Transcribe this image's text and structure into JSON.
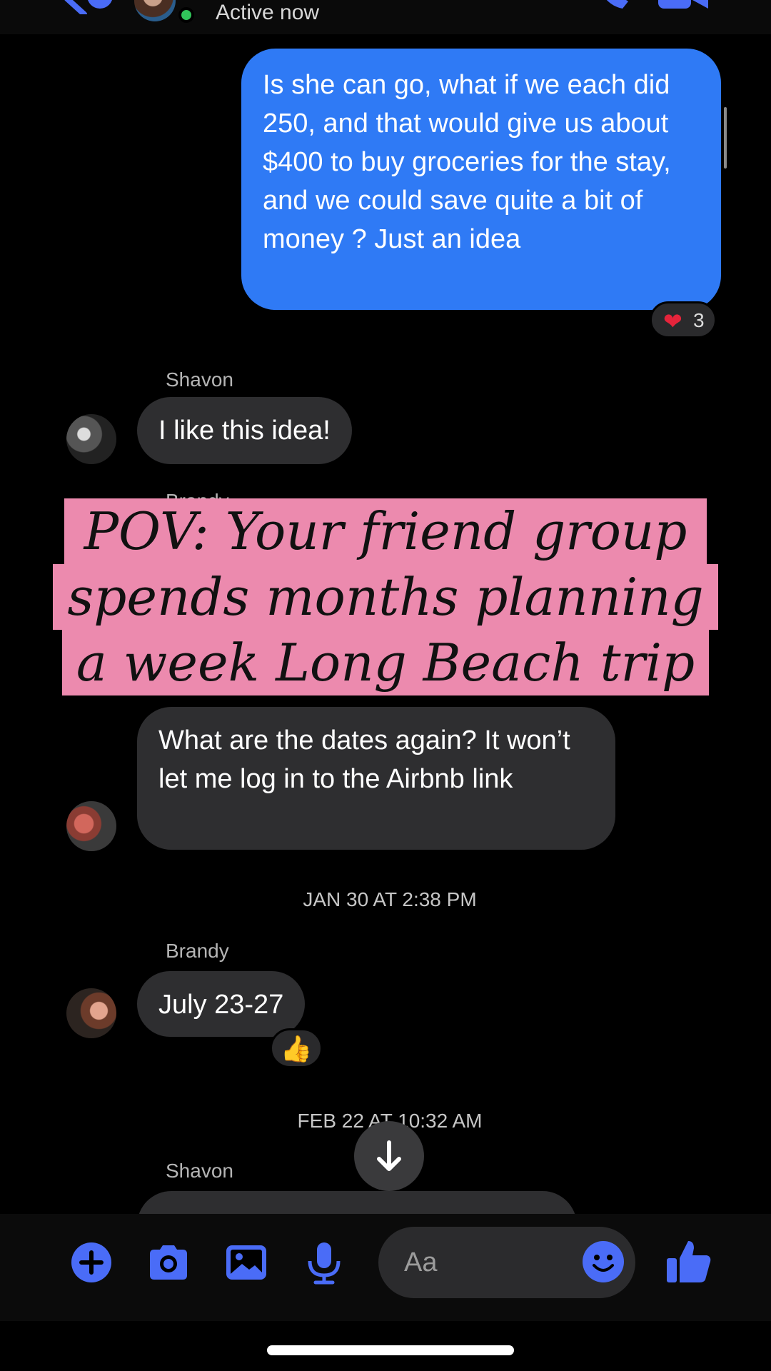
{
  "header": {
    "status": "Active now"
  },
  "messages": {
    "outgoing_1": "Is she can go, what if we each did 250, and that would give us about $400 to buy groceries for the stay, and we could save quite a bit of money ? Just an idea",
    "outgoing_1_reaction": {
      "emoji": "❤️",
      "count": "3"
    },
    "sender_1": "Shavon",
    "incoming_1": "I like this idea!",
    "sender_hidden": "Brandy",
    "incoming_2": "What are the dates again? It won’t let me log in to the Airbnb link",
    "timestamp_1": "JAN 30 AT 2:38 PM",
    "sender_2": "Brandy",
    "incoming_3": "July 23-27",
    "incoming_3_reaction": "👍",
    "timestamp_2": "FEB 22 AT 10:32 AM",
    "sender_3": "Shavon"
  },
  "caption": {
    "line1": "POV: Your friend group",
    "line2": "spends months planning",
    "line3": "a week Long Beach trip"
  },
  "composer": {
    "placeholder": "Aa"
  },
  "colors": {
    "accent": "#2f7af5",
    "icon_blue": "#4a6cf7",
    "incoming_bubble": "#2e2e30",
    "caption_bg": "#ec8aae",
    "online": "#31c45a"
  }
}
